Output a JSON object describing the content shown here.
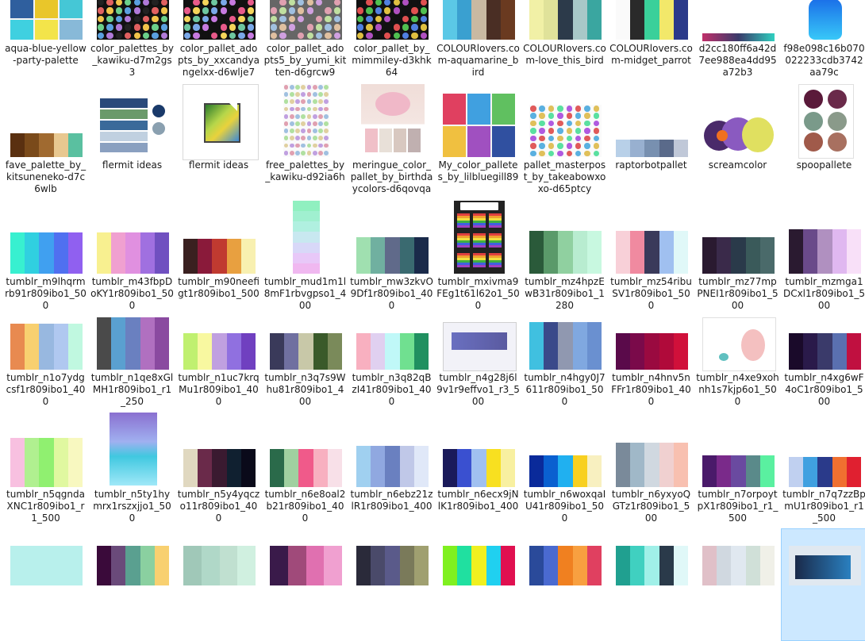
{
  "items": [
    {
      "label": "aqua-blue-yellow-party-palette",
      "kind": "grid",
      "colors": [
        "#2f5f9e",
        "#e9c62a",
        "#45c7d6",
        "#3fd0e0",
        "#f3e44a",
        "#88b9d8"
      ]
    },
    {
      "label": "color_palettes_by_kawiku-d7m2gs3",
      "kind": "dots",
      "colors": [
        "#222",
        "#e06060",
        "#f2c44a",
        "#6bd08a",
        "#5aa0e0",
        "#b07ad8"
      ]
    },
    {
      "label": "color_pallet_adopts_by_xxcandyangelxx-d6wlje7",
      "kind": "dots",
      "colors": [
        "#111",
        "#e85a8a",
        "#f5d55a",
        "#6ec7a0",
        "#7aa8e8",
        "#c77ae0"
      ]
    },
    {
      "label": "color_pallet_adopts5_by_yumi_kitten-d6grcw9",
      "kind": "dots",
      "colors": [
        "#666",
        "#e0a0b0",
        "#c0e0a0",
        "#a0c0e0",
        "#e0c0a0",
        "#d0a0e0"
      ]
    },
    {
      "label": "color_pallet_by_mimmiley-d3khk64",
      "kind": "dots",
      "colors": [
        "#111",
        "#e05050",
        "#50c050",
        "#5080e0",
        "#e0c040",
        "#b050c0"
      ]
    },
    {
      "label": "COLOURlovers.com-aquamarine_bird",
      "kind": "stripes",
      "colors": [
        "#5bc8e6",
        "#3aa0d0",
        "#c9b9a2",
        "#4a2e24",
        "#6a3a20"
      ]
    },
    {
      "label": "COLOURlovers.com-love_this_bird",
      "kind": "stripes",
      "colors": [
        "#f1f0a6",
        "#e0e29a",
        "#2c3a4a",
        "#a8c8c8",
        "#3aa6a0"
      ]
    },
    {
      "label": "COLOURlovers.com-midget_parrot",
      "kind": "stripes",
      "colors": [
        "#fafafa",
        "#2a2a2a",
        "#3ad09a",
        "#f2e86a",
        "#2a3a8a"
      ]
    },
    {
      "label": "d2cc180ff6a42d7ee988ea4dd95a72b3",
      "kind": "gradient",
      "colors": [
        "#c0306a",
        "#3a3a6a",
        "#30d0c0"
      ]
    },
    {
      "label": "f98e098c16b070022233cdb3742aa79c",
      "kind": "bottle",
      "colors": [
        "#1a6ee8",
        "#38c8f8"
      ]
    },
    {
      "label": "fave_palette_by_kitsuneneko-d7c6wlb",
      "kind": "stripes",
      "colors": [
        "#5a3010",
        "#7a4a1a",
        "#a06a30",
        "#e8c890",
        "#5ac0a0"
      ]
    },
    {
      "label": "flermit ideas",
      "kind": "flermit",
      "colors": [
        "#2a4a7a",
        "#6a9a6a",
        "#3a6a9a",
        "#c0d0e0",
        "#8aa0c0"
      ]
    },
    {
      "label": "flermit ideas",
      "kind": "fileicon",
      "colors": []
    },
    {
      "label": "free_palettes_by_kawiku-d92ia6h",
      "kind": "dots",
      "colors": [
        "#e0a0b0",
        "#a0c0e0",
        "#b0e0a0",
        "#e0d0a0",
        "#c0a0e0"
      ]
    },
    {
      "label": "meringue_color_pallet_by_birthdaycolors-d6qovqa",
      "kind": "meringue",
      "colors": [
        "#f0c0c8",
        "#e8e0d8",
        "#d8c8c0",
        "#c0b0b0"
      ]
    },
    {
      "label": "My_color_palletes_by_lilbluegill89",
      "kind": "grid",
      "colors": [
        "#e04060",
        "#40a0e0",
        "#60c060",
        "#f0c040",
        "#a050c0",
        "#3050a0"
      ]
    },
    {
      "label": "pallet_masterpost_by_takeabowxoxo-d65ptcy",
      "kind": "dots",
      "colors": [
        "#e05a5a",
        "#5ab0e0",
        "#e0c05a",
        "#5ae0a0",
        "#b05ae0"
      ]
    },
    {
      "label": "raptorbotpallet",
      "kind": "stripes",
      "colors": [
        "#b8d0e8",
        "#98b0d0",
        "#7890b0",
        "#5a6a8a",
        "#c0c8d8"
      ]
    },
    {
      "label": "screamcolor",
      "kind": "scream",
      "colors": [
        "#4a2a6a",
        "#8a5ac0",
        "#e0e060",
        "#f07020"
      ]
    },
    {
      "label": "spoopallete",
      "kind": "spoo",
      "colors": [
        "#5a1a3a",
        "#6a2a4a",
        "#7a9a8a",
        "#8a9a8a",
        "#a05a4a",
        "#a87060"
      ]
    },
    {
      "label": "tumblr_m9lhqrmrb91r809ibo1_500",
      "kind": "stripes",
      "colors": [
        "#38f0d0",
        "#30d0e0",
        "#40a0f0",
        "#5070f0",
        "#9060f0"
      ]
    },
    {
      "label": "tumblr_m43fbpDoKY1r809ibo1_500",
      "kind": "stripes",
      "colors": [
        "#f8f090",
        "#f0a0d0",
        "#e090e0",
        "#a070e0",
        "#7050c0"
      ]
    },
    {
      "label": "tumblr_m90neefigt1r809ibo1_500",
      "kind": "stripes",
      "colors": [
        "#3a2020",
        "#8a1a3a",
        "#c03a30",
        "#e8a040",
        "#f8f0b0"
      ]
    },
    {
      "label": "tumblr_mud1m1l8mF1rbvgpso1_400",
      "kind": "vstripes",
      "colors": [
        "#90f0c0",
        "#a0f0d0",
        "#b0f0e0",
        "#c8e8f0",
        "#d8d8f8",
        "#e8c8f8",
        "#f0b8f0"
      ]
    },
    {
      "label": "tumblr_mw3zkvO9Df1r809ibo1_400",
      "kind": "stripes",
      "colors": [
        "#a0e0b0",
        "#70b0a0",
        "#606a8a",
        "#3a6a70",
        "#1a2a4a"
      ]
    },
    {
      "label": "tumblr_mxivma9FEg1t61l62o1_500",
      "kind": "pride",
      "colors": [
        "#e04040",
        "#f0a030",
        "#f0e040",
        "#40b040",
        "#4060e0",
        "#a040c0"
      ]
    },
    {
      "label": "tumblr_mz4hpzEwB31r809ibo1_1280",
      "kind": "stripes",
      "colors": [
        "#2a5a3a",
        "#5a9a6a",
        "#90d0a0",
        "#b8ecd0",
        "#c8f8e0"
      ]
    },
    {
      "label": "tumblr_mz54ribuSV1r809ibo1_500",
      "kind": "stripes",
      "colors": [
        "#f8d0d8",
        "#f08aa0",
        "#3a3a5a",
        "#a0c0f0",
        "#e0f8f8"
      ]
    },
    {
      "label": "tumblr_mz77mpPNEI1r809ibo1_500",
      "kind": "stripes",
      "colors": [
        "#2a1a30",
        "#3a2a4a",
        "#2a3a4a",
        "#3a5a5a",
        "#4a6a6a"
      ]
    },
    {
      "label": "tumblr_mzmga1DCxl1r809ibo1_500",
      "kind": "stripes",
      "colors": [
        "#2a1a30",
        "#6a4a8a",
        "#b090c0",
        "#e0b8f0",
        "#f8e0f8"
      ]
    },
    {
      "label": "tumblr_n1o7ydgcsf1r809ibo1_400",
      "kind": "stripes",
      "colors": [
        "#e88a50",
        "#f8d070",
        "#98b8e0",
        "#b0c8f0",
        "#c0f8e0"
      ]
    },
    {
      "label": "tumblr_n1qe8xGlMH1r809ibo1_r1_250",
      "kind": "stripes",
      "colors": [
        "#4a4a4a",
        "#5aa0d0",
        "#6a80c0",
        "#b070c0",
        "#8a4aa0"
      ]
    },
    {
      "label": "tumblr_n1uc7krqMu1r809ibo1_400",
      "kind": "stripes",
      "colors": [
        "#c0f070",
        "#f8f8a0",
        "#c0a0e0",
        "#9070e0",
        "#7040c0"
      ]
    },
    {
      "label": "tumblr_n3q7s9Whu81r809ibo1_400",
      "kind": "stripes",
      "colors": [
        "#3a3a5a",
        "#7070a0",
        "#c8c8a8",
        "#3a5a2a",
        "#7a8a5a"
      ]
    },
    {
      "label": "tumblr_n3q82qBzI41r809ibo1_400",
      "kind": "stripes",
      "colors": [
        "#f8b0c0",
        "#e0d0f0",
        "#c0f8f8",
        "#70e090",
        "#209060"
      ]
    },
    {
      "label": "tumblr_n4g28j6l9v1r9effvo1_r3_500",
      "kind": "anime",
      "colors": [
        "#6a70c0",
        "#e0e0f0",
        "#5a5aa0"
      ]
    },
    {
      "label": "tumblr_n4hgy0J7611r809ibo1_500",
      "kind": "stripes",
      "colors": [
        "#40c0e0",
        "#3a4a8a",
        "#9098b0",
        "#80a8e0",
        "#6a90d0"
      ]
    },
    {
      "label": "tumblr_n4hnv5nFFr1r809ibo1_400",
      "kind": "stripes",
      "colors": [
        "#5a0a4a",
        "#7a0a4a",
        "#9a0a40",
        "#b00a3a",
        "#d0103a"
      ]
    },
    {
      "label": "tumblr_n4xe9xohnh1s7kjp6o1_500",
      "kind": "magura",
      "colors": [
        "#f0a0a0",
        "#60c0c0",
        "#f8e0e0"
      ]
    },
    {
      "label": "tumblr_n4xg6wF4oC1r809ibo1_500",
      "kind": "stripes",
      "colors": [
        "#1a0a2a",
        "#2a1a4a",
        "#3a3a6a",
        "#5a70b0",
        "#c01040"
      ]
    },
    {
      "label": "tumblr_n5qgndaXNC1r809ibo1_r1_500",
      "kind": "stripes",
      "colors": [
        "#f8c0e0",
        "#b0f090",
        "#90f070",
        "#e0f8a0",
        "#f8f8c0"
      ]
    },
    {
      "label": "tumblr_n5ty1hymrx1rszxjjo1_500",
      "kind": "ocean",
      "colors": [
        "#8a70d0",
        "#a0b0f0",
        "#40c8e0",
        "#a0e8f8"
      ]
    },
    {
      "label": "tumblr_n5y4yqczo11r809ibo1_400",
      "kind": "stripes",
      "colors": [
        "#e0d8c0",
        "#6a2a4a",
        "#3a1a30",
        "#102030",
        "#0a0a1a"
      ]
    },
    {
      "label": "tumblr_n6e8oal2b21r809ibo1_400",
      "kind": "stripes",
      "colors": [
        "#2a6a4a",
        "#a0d0a0",
        "#f05a8a",
        "#f8b0c0",
        "#f8e0e8"
      ]
    },
    {
      "label": "tumblr_n6ebz21zlR1r809ibo1_400",
      "kind": "stripes",
      "colors": [
        "#a0d0f0",
        "#90a8e0",
        "#6a80c0",
        "#c0c8e8",
        "#e0e8f8"
      ]
    },
    {
      "label": "tumblr_n6ecx9jNlK1r809ibo1_400",
      "kind": "stripes",
      "colors": [
        "#1a1a5a",
        "#3a50d0",
        "#a0c0f0",
        "#f8e020",
        "#f8f0a0"
      ]
    },
    {
      "label": "tumblr_n6woxqaIU41r809ibo1_500",
      "kind": "stripes",
      "colors": [
        "#0a2a9a",
        "#0a60d0",
        "#20b0f0",
        "#f8d020",
        "#f8f0c0"
      ]
    },
    {
      "label": "tumblr_n6yxyoQGTz1r809ibo1_500",
      "kind": "stripes",
      "colors": [
        "#7a8a9a",
        "#a0b8c8",
        "#d0d8e0",
        "#f0d0d0",
        "#f8c0b0"
      ]
    },
    {
      "label": "tumblr_n7orpoytpX1r809ibo1_r1_500",
      "kind": "stripes",
      "colors": [
        "#4a1a6a",
        "#7a2a8a",
        "#6a4aa0",
        "#5a8a8a",
        "#5af0a0"
      ]
    },
    {
      "label": "tumblr_n7q7zzBpmU1r809ibo1_r1_500",
      "kind": "stripes",
      "colors": [
        "#c0d0f0",
        "#40a0e0",
        "#2a3a8a",
        "#f07030",
        "#e02030"
      ]
    },
    {
      "label": "",
      "kind": "stripes",
      "colors": [
        "#b8f0ec"
      ]
    },
    {
      "label": "",
      "kind": "stripes",
      "colors": [
        "#3a0a3a",
        "#6a4a7a",
        "#5aa090",
        "#8ad0a0",
        "#f8d070"
      ]
    },
    {
      "label": "",
      "kind": "stripes",
      "colors": [
        "#a0c8b8",
        "#b0d8c8",
        "#c0e0d0",
        "#d0f0e0"
      ]
    },
    {
      "label": "",
      "kind": "stripes",
      "colors": [
        "#3a1a4a",
        "#a04a7a",
        "#e070b0",
        "#f0a0d0"
      ]
    },
    {
      "label": "",
      "kind": "stripes",
      "colors": [
        "#2a2a3a",
        "#4a4a6a",
        "#5a5a8a",
        "#7a7a5a",
        "#a0a070"
      ]
    },
    {
      "label": "",
      "kind": "stripes",
      "colors": [
        "#80f020",
        "#20e0a0",
        "#f0f020",
        "#20d0f0",
        "#e01050"
      ]
    },
    {
      "label": "",
      "kind": "stripes",
      "colors": [
        "#2a4a9a",
        "#4a6ad0",
        "#f08020",
        "#f8a040",
        "#e04060"
      ]
    },
    {
      "label": "",
      "kind": "stripes",
      "colors": [
        "#20a090",
        "#40d0c0",
        "#a0f0e8",
        "#2a3a4a",
        "#e0f8f8"
      ]
    },
    {
      "label": "",
      "kind": "stripes",
      "colors": [
        "#e0c0c8",
        "#d0d8e0",
        "#e0e8f0",
        "#d0e0d8",
        "#f0f0e8"
      ]
    },
    {
      "label": "",
      "kind": "screenshot",
      "colors": [
        "#1a2a4a",
        "#2a80c0",
        "#e0e8f0"
      ]
    }
  ]
}
